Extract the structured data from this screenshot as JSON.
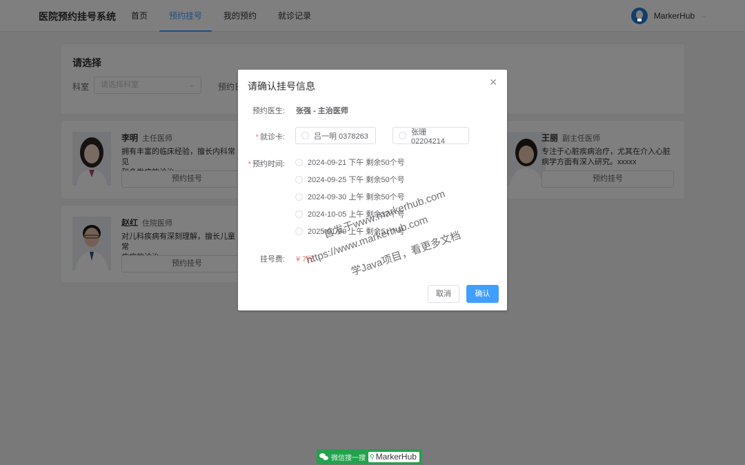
{
  "header": {
    "brand": "医院预约挂号系统",
    "nav": [
      "首页",
      "预约挂号",
      "我的预约",
      "就诊记录"
    ],
    "active_index": 1,
    "user_name": "MarkerHub"
  },
  "select_panel": {
    "title": "请选择",
    "dept_label": "科室",
    "dept_placeholder": "请选择科室",
    "date_label": "预约日"
  },
  "doctors": [
    {
      "name": "李明",
      "title": "主任医师",
      "desc": "拥有丰富的临床经验，擅长内科常见",
      "desc2": "和多发病的诊治。",
      "button": "预约挂号"
    },
    {
      "name": "王丽",
      "title": "副主任医师",
      "desc": "专注于心脏疾病治疗，尤其在介入心脏",
      "desc2": "病学方面有深入研究。xxxxx",
      "button": "预约挂号"
    },
    {
      "name": "赵红",
      "title": "住院医师",
      "desc": "对儿科疾病有深刻理解，擅长儿童常",
      "desc2": "疾病的诊治。",
      "button": "预约挂号"
    }
  ],
  "dialog": {
    "title": "请确认挂号信息",
    "doctor_label": "预约医生:",
    "doctor_value": "张强 - 主治医师",
    "card_label": "就诊卡:",
    "cards": [
      "吕一明 0378263",
      "张珊 02204214"
    ],
    "time_label": "预约时间:",
    "times": [
      "2024-09-21 下午 剩余50个号",
      "2024-09-25 下午 剩余50个号",
      "2024-09-30 上午 剩余50个号",
      "2024-10-05 上午 剩余37个号",
      "2025-01-09 上午 剩余51个号"
    ],
    "fee_label": "挂号费:",
    "fee_value": "¥ 7元",
    "cancel_label": "取消",
    "confirm_label": "确认"
  },
  "watermark": {
    "line1": "首发于www.markerhub.com",
    "line2": "https://www.markerhub.com",
    "line3": "学Java项目，看更多文档"
  },
  "footer": {
    "text": "微信搜一搜",
    "search_text": "MarkerHub"
  },
  "colors": {
    "primary": "#409eff",
    "danger": "#f56c6c",
    "wechat_green": "#23a24d"
  }
}
